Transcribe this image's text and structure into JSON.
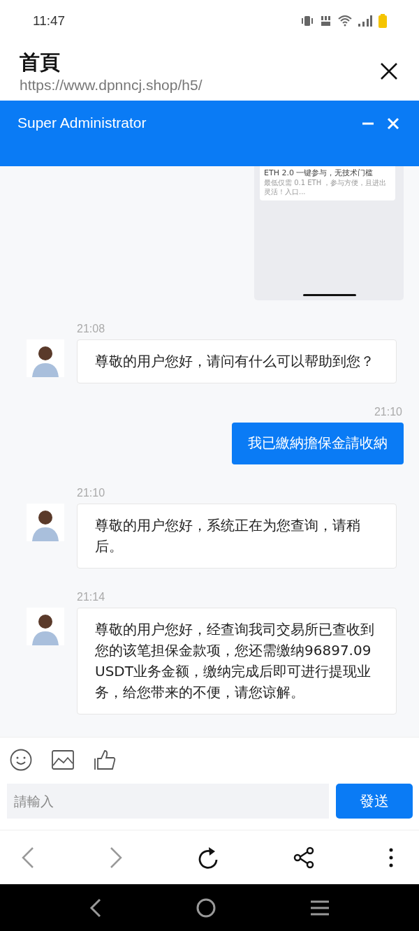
{
  "status_bar": {
    "time": "11:47"
  },
  "browser": {
    "title": "首頁",
    "url": "https://www.dpnncj.shop/h5/"
  },
  "chat_header": {
    "title": "Super Administrator"
  },
  "messages": [
    {
      "kind": "image",
      "outgoing": true,
      "lines": [
        "ETH 2.0 一键参与，无技术门槛",
        "最低仅需 0.1 ETH ，参与方便，且进出灵活！入口..."
      ]
    },
    {
      "kind": "text",
      "outgoing": false,
      "time": "21:08",
      "text": "尊敬的用户您好，请问有什么可以帮助到您？"
    },
    {
      "kind": "text",
      "outgoing": true,
      "time": "21:10",
      "text": "我已繳納擔保金請收納"
    },
    {
      "kind": "text",
      "outgoing": false,
      "time": "21:10",
      "text": "尊敬的用户您好，系统正在为您查询，请稍后。"
    },
    {
      "kind": "text",
      "outgoing": false,
      "time": "21:14",
      "text": "尊敬的用户您好，经查询我司交易所已查收到您的该笔担保金款项，您还需缴纳96897.09 USDT业务金额，缴纳完成后即可进行提现业务，给您带来的不便，请您谅解。"
    }
  ],
  "composer": {
    "placeholder": "請輸入",
    "send": "發送"
  },
  "browser_toolbar": {
    "back": {
      "disabled": true
    },
    "forward": {
      "disabled": true
    }
  }
}
